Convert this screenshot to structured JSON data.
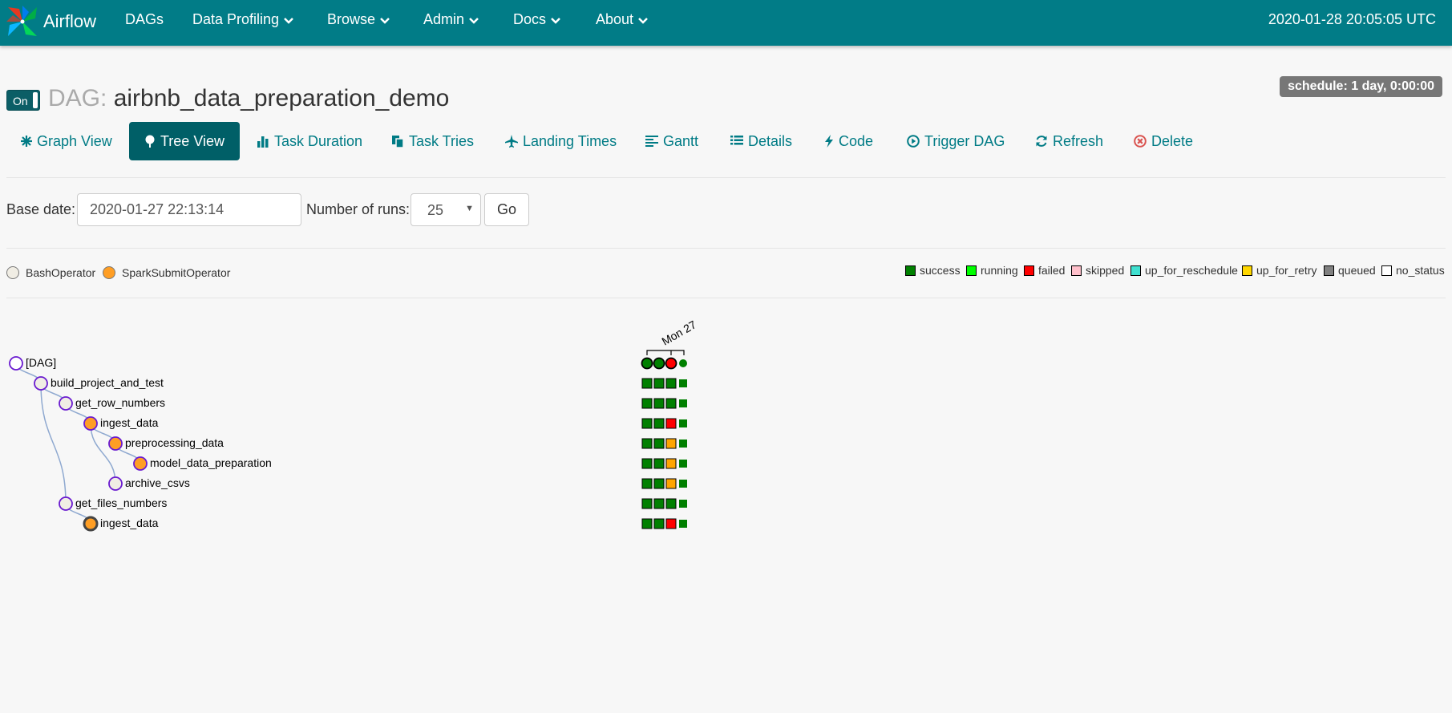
{
  "navbar": {
    "brand": "Airflow",
    "items": [
      {
        "label": "DAGs",
        "dropdown": false
      },
      {
        "label": "Data Profiling",
        "dropdown": true
      },
      {
        "label": "Browse",
        "dropdown": true
      },
      {
        "label": "Admin",
        "dropdown": true
      },
      {
        "label": "Docs",
        "dropdown": true
      },
      {
        "label": "About",
        "dropdown": true
      }
    ],
    "clock": "2020-01-28 20:05:05 UTC"
  },
  "dag": {
    "toggle_label": "On",
    "title_prefix": "DAG:",
    "dag_id": "airbnb_data_preparation_demo",
    "schedule": "schedule: 1 day, 0:00:00"
  },
  "tabs": [
    {
      "label": "Graph View",
      "icon": "asterisk-icon"
    },
    {
      "label": "Tree View",
      "icon": "tree-icon",
      "active": true
    },
    {
      "label": "Task Duration",
      "icon": "bar-chart-icon"
    },
    {
      "label": "Task Tries",
      "icon": "duplicate-icon"
    },
    {
      "label": "Landing Times",
      "icon": "plane-icon"
    },
    {
      "label": "Gantt",
      "icon": "align-left-icon"
    },
    {
      "label": "Details",
      "icon": "list-icon"
    },
    {
      "label": "Code",
      "icon": "flash-icon"
    },
    {
      "label": "Trigger DAG",
      "icon": "play-circle-icon"
    },
    {
      "label": "Refresh",
      "icon": "refresh-icon"
    },
    {
      "label": "Delete",
      "icon": "remove-circle-icon"
    }
  ],
  "controls": {
    "base_date_label": "Base date:",
    "base_date_value": "2020-01-27 22:13:14",
    "num_runs_label": "Number of runs:",
    "num_runs_value": "25",
    "go_label": "Go"
  },
  "operators": [
    {
      "name": "BashOperator",
      "color": "#f0ede4"
    },
    {
      "name": "SparkSubmitOperator",
      "color": "#ff9e24"
    }
  ],
  "states": [
    {
      "name": "success",
      "color": "#008000"
    },
    {
      "name": "running",
      "color": "#00ff00"
    },
    {
      "name": "failed",
      "color": "#ff0000"
    },
    {
      "name": "skipped",
      "color": "#ffc0cb"
    },
    {
      "name": "up_for_reschedule",
      "color": "#40e0d0"
    },
    {
      "name": "up_for_retry",
      "color": "#ffd700"
    },
    {
      "name": "queued",
      "color": "#808080"
    },
    {
      "name": "no_status",
      "color": "#ffffff"
    }
  ],
  "tree": {
    "date_header": "Mon 27",
    "nodes": [
      {
        "label": "[DAG]",
        "operator": "dag",
        "depth": 0,
        "runs": [
          "success",
          "success",
          "failed",
          "success"
        ]
      },
      {
        "label": "build_project_and_test",
        "operator": "BashOperator",
        "depth": 1,
        "runs": [
          "success",
          "success",
          "success",
          "success"
        ]
      },
      {
        "label": "get_row_numbers",
        "operator": "BashOperator",
        "depth": 2,
        "runs": [
          "success",
          "success",
          "success",
          "success"
        ]
      },
      {
        "label": "ingest_data",
        "operator": "SparkSubmitOperator",
        "depth": 3,
        "runs": [
          "success",
          "success",
          "failed",
          "success"
        ]
      },
      {
        "label": "preprocessing_data",
        "operator": "SparkSubmitOperator",
        "depth": 4,
        "runs": [
          "success",
          "success",
          "upstream_failed",
          "success"
        ]
      },
      {
        "label": "model_data_preparation",
        "operator": "SparkSubmitOperator",
        "depth": 5,
        "runs": [
          "success",
          "success",
          "upstream_failed",
          "success"
        ]
      },
      {
        "label": "archive_csvs",
        "operator": "BashOperator",
        "depth": 4,
        "runs": [
          "success",
          "success",
          "upstream_failed",
          "success"
        ]
      },
      {
        "label": "get_files_numbers",
        "operator": "BashOperator",
        "depth": 2,
        "runs": [
          "success",
          "success",
          "success",
          "success"
        ]
      },
      {
        "label": "ingest_data",
        "operator": "SparkSubmitOperator",
        "depth": 3,
        "collapsed": true,
        "runs": [
          "success",
          "success",
          "failed",
          "success"
        ]
      }
    ]
  }
}
